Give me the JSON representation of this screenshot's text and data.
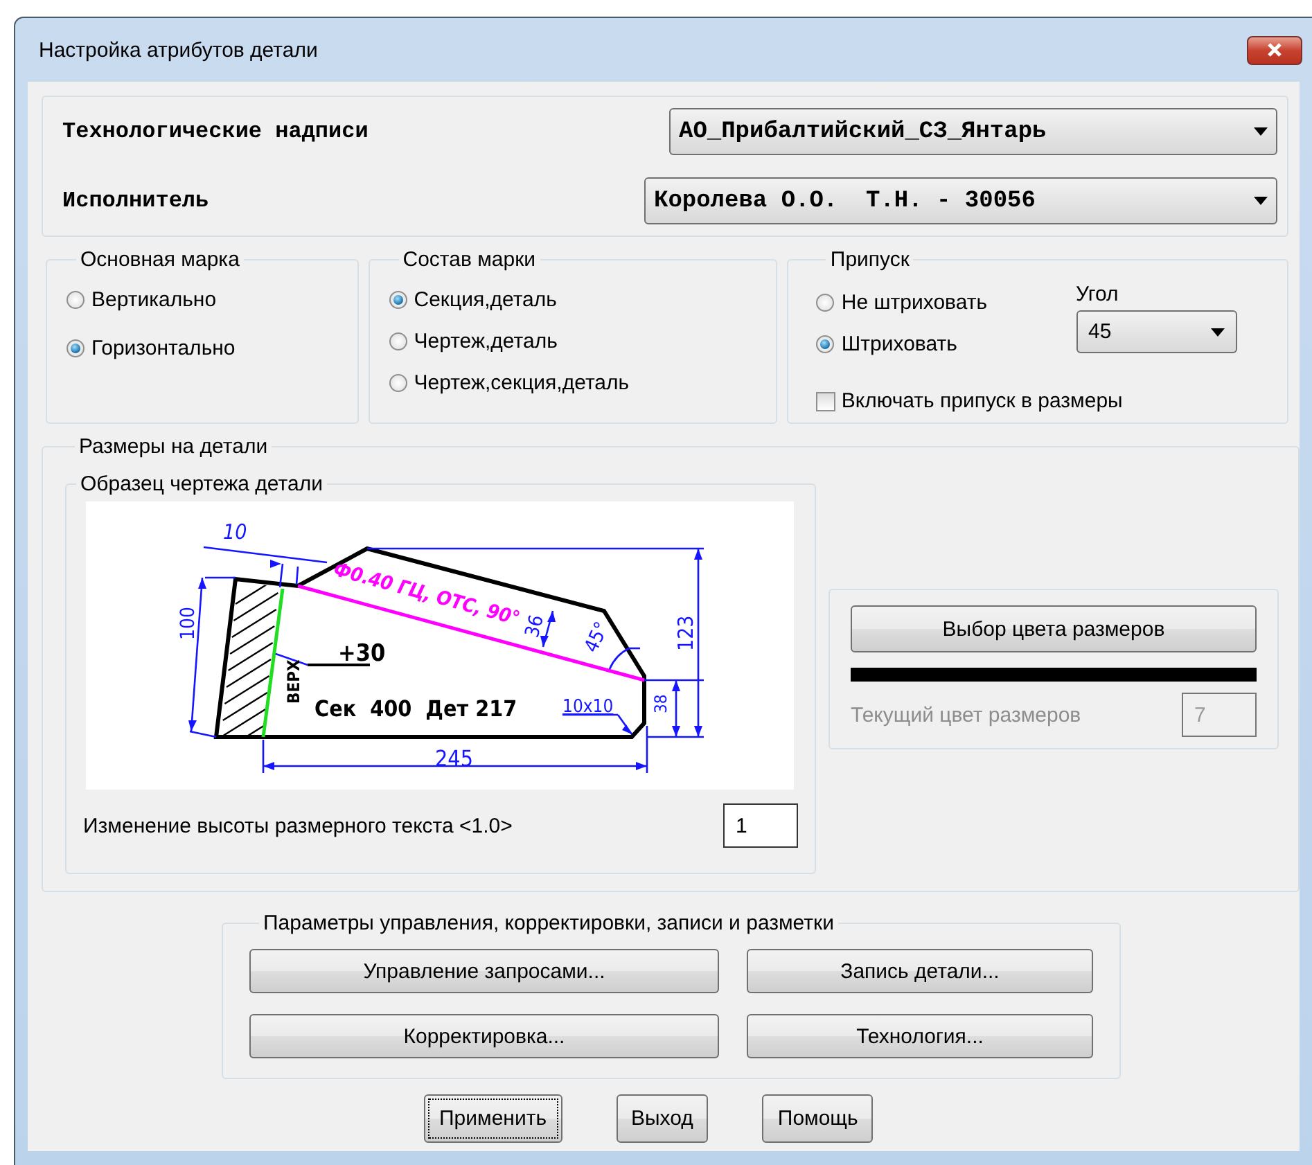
{
  "window": {
    "title": "Настройка атрибутов детали"
  },
  "header": {
    "fields": [
      {
        "label": "Технологические надписи",
        "value": "АО_Прибалтийский_СЗ_Янтарь"
      },
      {
        "label": "Исполнитель",
        "value": "Королева О.О.  Т.Н. - 30056"
      }
    ]
  },
  "main_mark": {
    "title": "Основная марка",
    "options": [
      {
        "label": "Вертикально",
        "selected": false
      },
      {
        "label": "Горизонтально",
        "selected": true
      }
    ]
  },
  "mark_content": {
    "title": "Состав марки",
    "options": [
      {
        "label": "Секция,деталь",
        "selected": true
      },
      {
        "label": "Чертеж,деталь",
        "selected": false
      },
      {
        "label": "Чертеж,секция,деталь",
        "selected": false
      }
    ]
  },
  "allowance": {
    "title": "Припуск",
    "options": [
      {
        "label": "Не штриховать",
        "selected": false
      },
      {
        "label": "Штриховать",
        "selected": true
      }
    ],
    "angle_label": "Угол",
    "angle_value": "45",
    "include_label": "Включать припуск в размеры",
    "include_checked": false
  },
  "dimensions": {
    "title": "Размеры на детали",
    "sample": {
      "title": "Образец чертежа детали",
      "labels": [
        "10",
        "100",
        "Ф0.40 ГЦ, ОТС, 90°",
        "36",
        "45°",
        "123",
        "+30",
        "ВЕРХ",
        "Сек  400  Дет 217",
        "10x10",
        "38",
        "245"
      ],
      "text_height_label": "Изменение высоты размерного текста <1.0>",
      "text_height_value": "1"
    },
    "color_button": "Выбор цвета размеров",
    "current_color_label": "Текущий цвет размеров",
    "current_color_value": "7",
    "current_color_disabled": true
  },
  "parameters": {
    "title": "Параметры управления, корректировки, записи и разметки",
    "buttons": [
      "Управление запросами...",
      "Запись детали...",
      "Корректировка...",
      "Технология..."
    ]
  },
  "buttons": [
    {
      "label": "Применить",
      "focused": true
    },
    {
      "label": "Выход",
      "focused": false
    },
    {
      "label": "Помощь",
      "focused": false
    }
  ]
}
